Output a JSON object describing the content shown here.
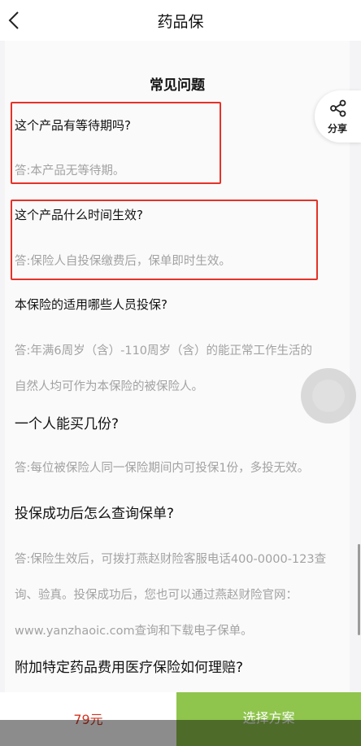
{
  "nav": {
    "title": "药品保"
  },
  "faq": {
    "title": "常见问题",
    "items": [
      {
        "q": "这个产品有等待期吗?",
        "a": [
          "答:本产品无等待期。"
        ]
      },
      {
        "q": "这个产品什么时间生效?",
        "a": [
          "答:保险人自投保缴费后，保单即时生效。"
        ]
      },
      {
        "q": "本保险的适用哪些人员投保?",
        "a": [
          "答:年满6周岁（含）-110周岁（含）的能正常工作生活的",
          "自然人均可作为本保险的被保险人。"
        ]
      },
      {
        "q": "一个人能买几份?",
        "a": [
          "答:每位被保险人同一保险期间内可投保1份，多投无效。"
        ]
      },
      {
        "q": "投保成功后怎么查询保单?",
        "a": [
          "答:保险生效后，可拨打燕赵财险客服电话400-0000-123查",
          "询、验真。投保成功后，您也可以通过燕赵财险官网：",
          "www.yanzhaoic.com查询和下载电子保单。"
        ]
      },
      {
        "q": "附加特定药品费用医疗保险如何理赔?",
        "a": []
      }
    ]
  },
  "share": {
    "label": "分享",
    "icon": "share-icon"
  },
  "bottom": {
    "price": "79元",
    "button": "选择方案"
  },
  "colors": {
    "accent_green": "#8fc44d",
    "price_red": "#d5331f",
    "highlight_red": "#e53228"
  }
}
